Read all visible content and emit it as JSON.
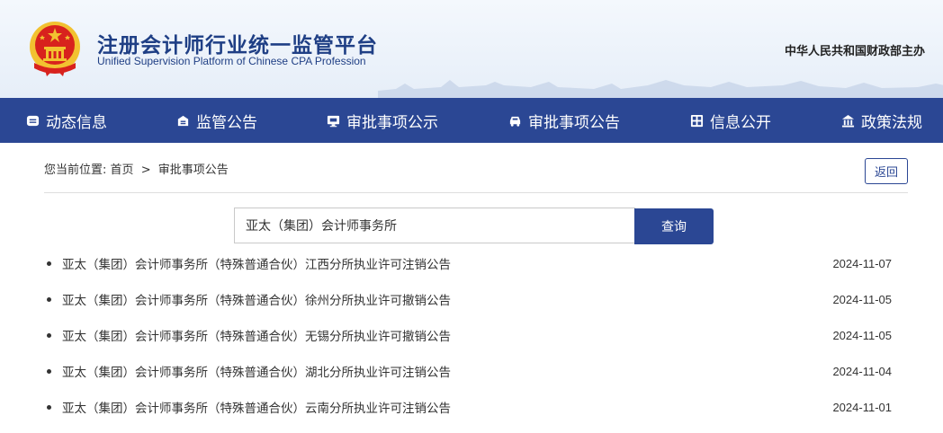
{
  "header": {
    "title": "注册会计师行业统一监管平台",
    "subtitle": "Unified Supervision Platform of Chinese CPA Profession",
    "sponsor": "中华人民共和国财政部主办",
    "emblem_icon": "national-emblem"
  },
  "nav": {
    "items": [
      {
        "label": "动态信息",
        "icon": "news-icon"
      },
      {
        "label": "监管公告",
        "icon": "announcement-icon"
      },
      {
        "label": "审批事项公示",
        "icon": "monitor-icon"
      },
      {
        "label": "审批事项公告",
        "icon": "car-icon"
      },
      {
        "label": "信息公开",
        "icon": "grid-icon"
      },
      {
        "label": "政策法规",
        "icon": "bank-icon"
      }
    ]
  },
  "breadcrumb": {
    "prefix": "您当前位置:",
    "home": "首页",
    "separator": ">",
    "current": "审批事项公告"
  },
  "back_label": "返回",
  "search": {
    "value": "亚太（集团）会计师事务所",
    "button_label": "查询"
  },
  "results": [
    {
      "title": "亚太（集团）会计师事务所（特殊普通合伙）江西分所执业许可注销公告",
      "date": "2024-11-07"
    },
    {
      "title": "亚太（集团）会计师事务所（特殊普通合伙）徐州分所执业许可撤销公告",
      "date": "2024-11-05"
    },
    {
      "title": "亚太（集团）会计师事务所（特殊普通合伙）无锡分所执业许可撤销公告",
      "date": "2024-11-05"
    },
    {
      "title": "亚太（集团）会计师事务所（特殊普通合伙）湖北分所执业许可注销公告",
      "date": "2024-11-04"
    },
    {
      "title": "亚太（集团）会计师事务所（特殊普通合伙）云南分所执业许可注销公告",
      "date": "2024-11-01"
    }
  ],
  "colors": {
    "primary": "#2b4794",
    "title_blue": "#1f3f85",
    "emblem_red": "#d8221d",
    "emblem_gold": "#f2c230"
  }
}
